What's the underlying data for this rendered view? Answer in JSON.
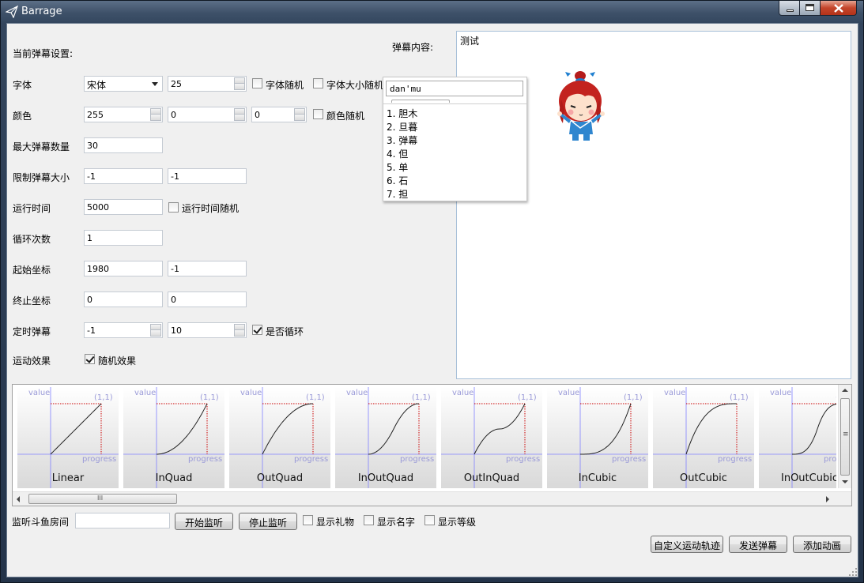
{
  "window": {
    "title": "Barrage"
  },
  "settings": {
    "heading": "当前弹幕设置:",
    "font_label": "字体",
    "font_family": "宋体",
    "font_size": "25",
    "font_random": "字体随机",
    "font_size_random": "字体大小随机",
    "color_label": "颜色",
    "color_r": "255",
    "color_g": "0",
    "color_b": "0",
    "color_random": "颜色随机",
    "max_count_label": "最大弹幕数量",
    "max_count": "30",
    "size_limit_label": "限制弹幕大小",
    "size_limit_w": "-1",
    "size_limit_h": "-1",
    "run_time_label": "运行时间",
    "run_time": "5000",
    "run_time_random": "运行时间随机",
    "loop_label": "循环次数",
    "loop_count": "1",
    "start_label": "起始坐标",
    "start_x": "1980",
    "start_y": "-1",
    "end_label": "终止坐标",
    "end_x": "0",
    "end_y": "0",
    "timer_label": "定时弹幕",
    "timer_a": "-1",
    "timer_b": "10",
    "is_loop": "是否循环",
    "motion_label": "运动效果",
    "random_effect": "随机效果"
  },
  "content": {
    "label": "弹幕内容:",
    "text": "测试"
  },
  "ime": {
    "input": "dan'mu",
    "candidates": [
      "1. 胆木",
      "2. 旦暮",
      "3. 弹幕",
      "4. 但",
      "5. 单",
      "6. 石",
      "7. 担"
    ]
  },
  "curves": {
    "axis_value": "value",
    "axis_progress": "progress",
    "corner": "(1,1)",
    "items": [
      {
        "name": "Linear",
        "kind": "linear"
      },
      {
        "name": "InQuad",
        "kind": "inquad"
      },
      {
        "name": "OutQuad",
        "kind": "outquad"
      },
      {
        "name": "InOutQuad",
        "kind": "inoutquad"
      },
      {
        "name": "OutInQuad",
        "kind": "outinquad"
      },
      {
        "name": "InCubic",
        "kind": "incubic"
      },
      {
        "name": "OutCubic",
        "kind": "outcubic"
      },
      {
        "name": "InOutCubic",
        "kind": "inoutcubic"
      }
    ],
    "vscroll_grip": "≡",
    "hscroll_grip": "III"
  },
  "bottom": {
    "room_label": "监听斗鱼房间",
    "room_value": "",
    "start_btn": "开始监听",
    "stop_btn": "停止监听",
    "show_gift": "显示礼物",
    "show_name": "显示名字",
    "show_level": "显示等级",
    "custom_btn": "自定义运动轨迹",
    "send_btn": "发送弹幕",
    "anim_btn": "添加动画"
  },
  "colors": {
    "titlebar": "#3e5169",
    "close_button": "#c4452b",
    "client_bg": "#f0f0f0",
    "axis": "#8080ff",
    "guide": "#cc0000"
  }
}
